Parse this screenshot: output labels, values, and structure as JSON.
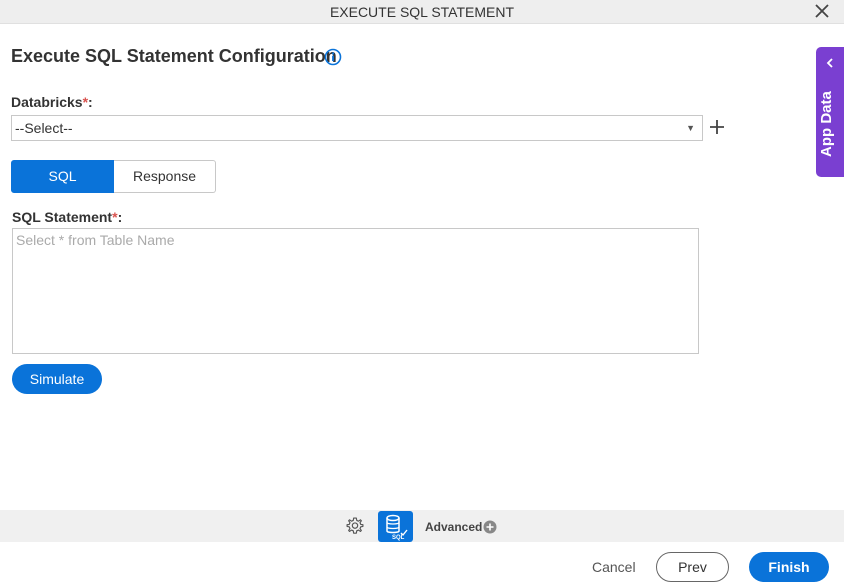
{
  "window": {
    "title": "EXECUTE SQL STATEMENT"
  },
  "page": {
    "heading": "Execute SQL Statement Configuration"
  },
  "databricks": {
    "label": "Databricks",
    "required_mark": "*",
    "colon": ":",
    "selected": "--Select--"
  },
  "tabs": {
    "sql": "SQL",
    "response": "Response"
  },
  "sql_statement": {
    "label": "SQL Statement",
    "required_mark": "*",
    "colon": ":",
    "placeholder": "Select * from Table Name"
  },
  "buttons": {
    "simulate": "Simulate",
    "cancel": "Cancel",
    "prev": "Prev",
    "finish": "Finish"
  },
  "side_panel": {
    "label": "App Data"
  },
  "footer": {
    "advanced": "Advanced",
    "sql_badge": "SQL"
  },
  "colors": {
    "primary": "#0a73d9",
    "side_panel": "#7a3fd1",
    "required": "#d9534f"
  }
}
